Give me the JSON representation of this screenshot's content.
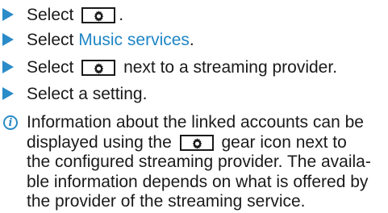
{
  "steps": [
    {
      "before": "Select",
      "after": "."
    },
    {
      "before": "Select",
      "link": "Music services",
      "after": "."
    },
    {
      "before": "Select",
      "after": "next to a streaming provider."
    },
    {
      "text": "Select a setting."
    }
  ],
  "note": {
    "line1": "Information about the linked accounts can be",
    "line2_before": "displayed using the",
    "line2_after": "gear icon next to",
    "line3": "the configured streaming provider. The availa-",
    "line4": "ble information depends on what is offered by",
    "line5": "the provider of the streaming service."
  },
  "colors": {
    "accent": "#2a8cc8",
    "link": "#1f86c6",
    "text": "#1a1a1a"
  },
  "icons": [
    "step-arrow-icon",
    "gear-icon",
    "info-icon"
  ]
}
